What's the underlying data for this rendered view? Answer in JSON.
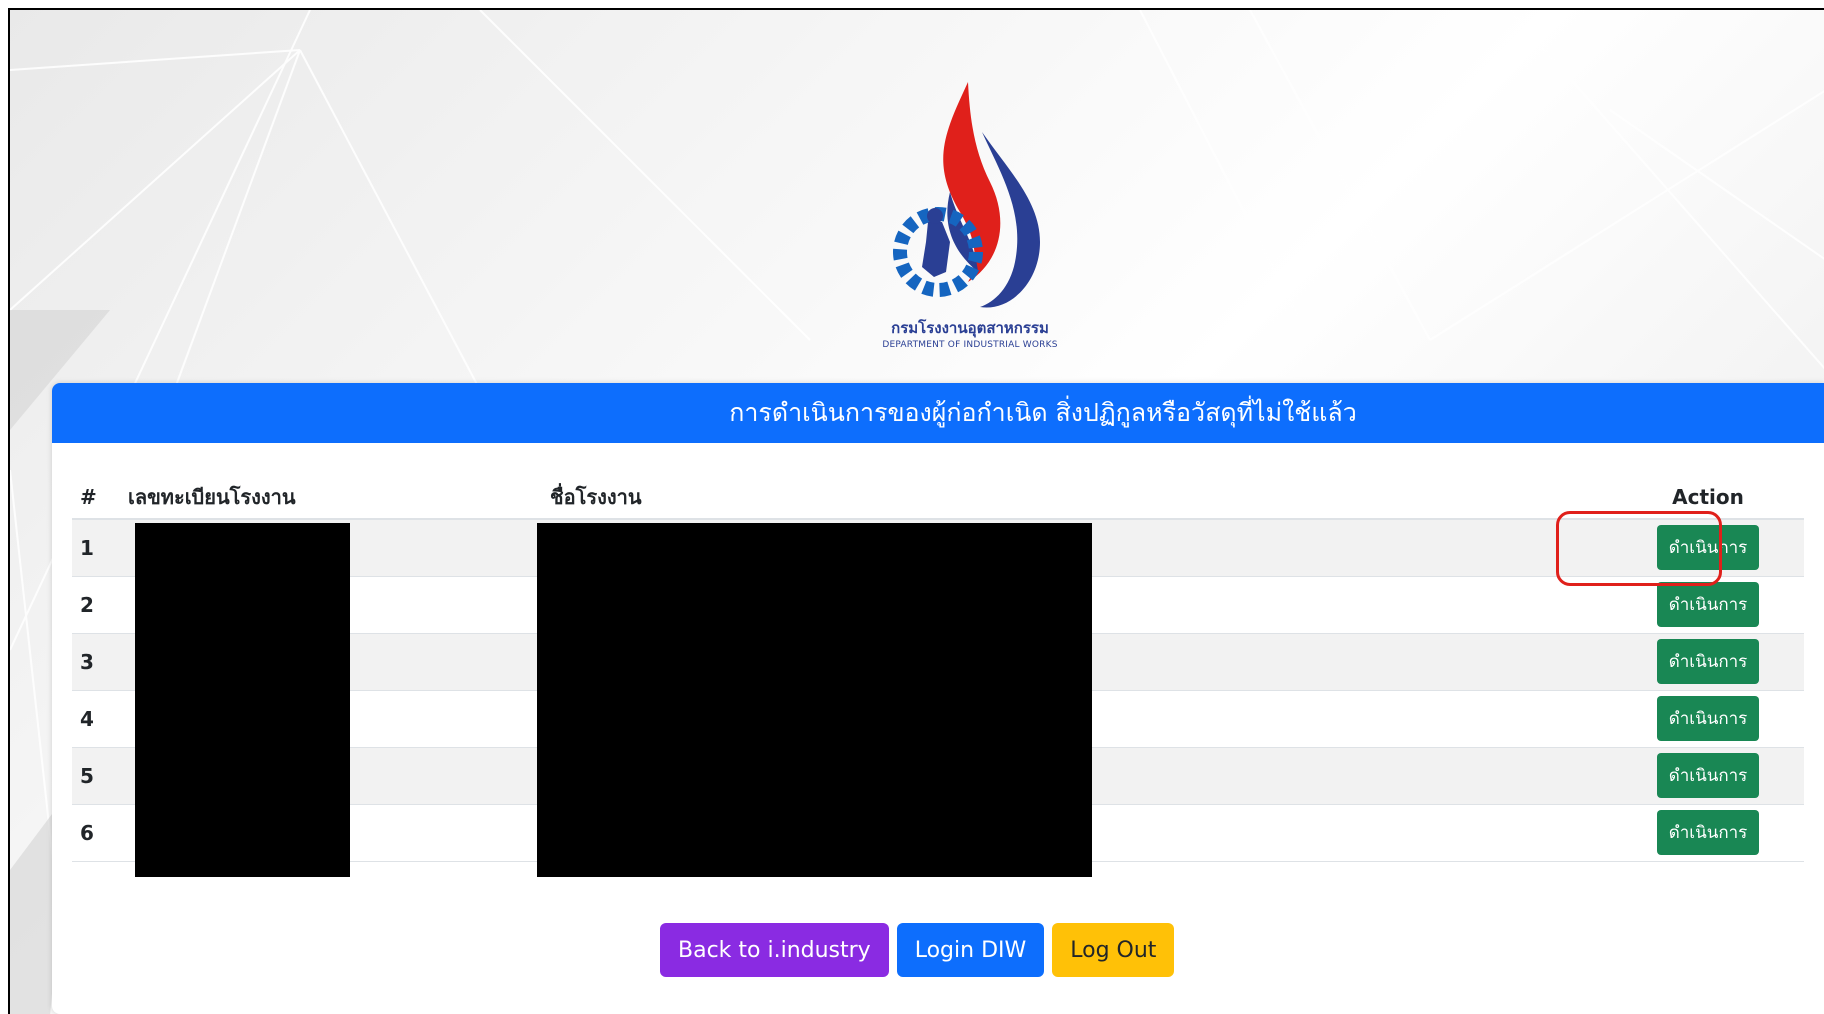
{
  "logo": {
    "org_thai": "กรมโรงงานอุตสาหกรรม",
    "org_eng": "DEPARTMENT OF INDUSTRIAL WORKS",
    "icon": "diw-emblem-icon",
    "colors": {
      "blue": "#2a3f94",
      "red": "#e0201b",
      "gear": "#1565c0"
    }
  },
  "header": {
    "title": "การดำเนินการของผู้ก่อกำเนิด สิ่งปฏิกูลหรือวัสดุที่ไม่ใช้แล้ว",
    "color": "#0d6efd"
  },
  "table": {
    "columns": [
      "#",
      "เลขทะเบียนโรงงาน",
      "ชื่อโรงงาน",
      "Action"
    ],
    "rows": [
      {
        "num": "1",
        "action_label": "ดำเนินการ"
      },
      {
        "num": "2",
        "action_label": "ดำเนินการ"
      },
      {
        "num": "3",
        "action_label": "ดำเนินการ"
      },
      {
        "num": "4",
        "action_label": "ดำเนินการ"
      },
      {
        "num": "5",
        "action_label": "ดำเนินการ"
      },
      {
        "num": "6",
        "action_label": "ดำเนินการ"
      }
    ],
    "action_color": "#198754",
    "highlight_color": "#e0201b"
  },
  "footer": {
    "back_label": "Back to i.industry",
    "login_label": "Login DIW",
    "logout_label": "Log Out",
    "colors": {
      "back": "#8a2be2",
      "login": "#0d6efd",
      "logout": "#ffc107"
    }
  }
}
